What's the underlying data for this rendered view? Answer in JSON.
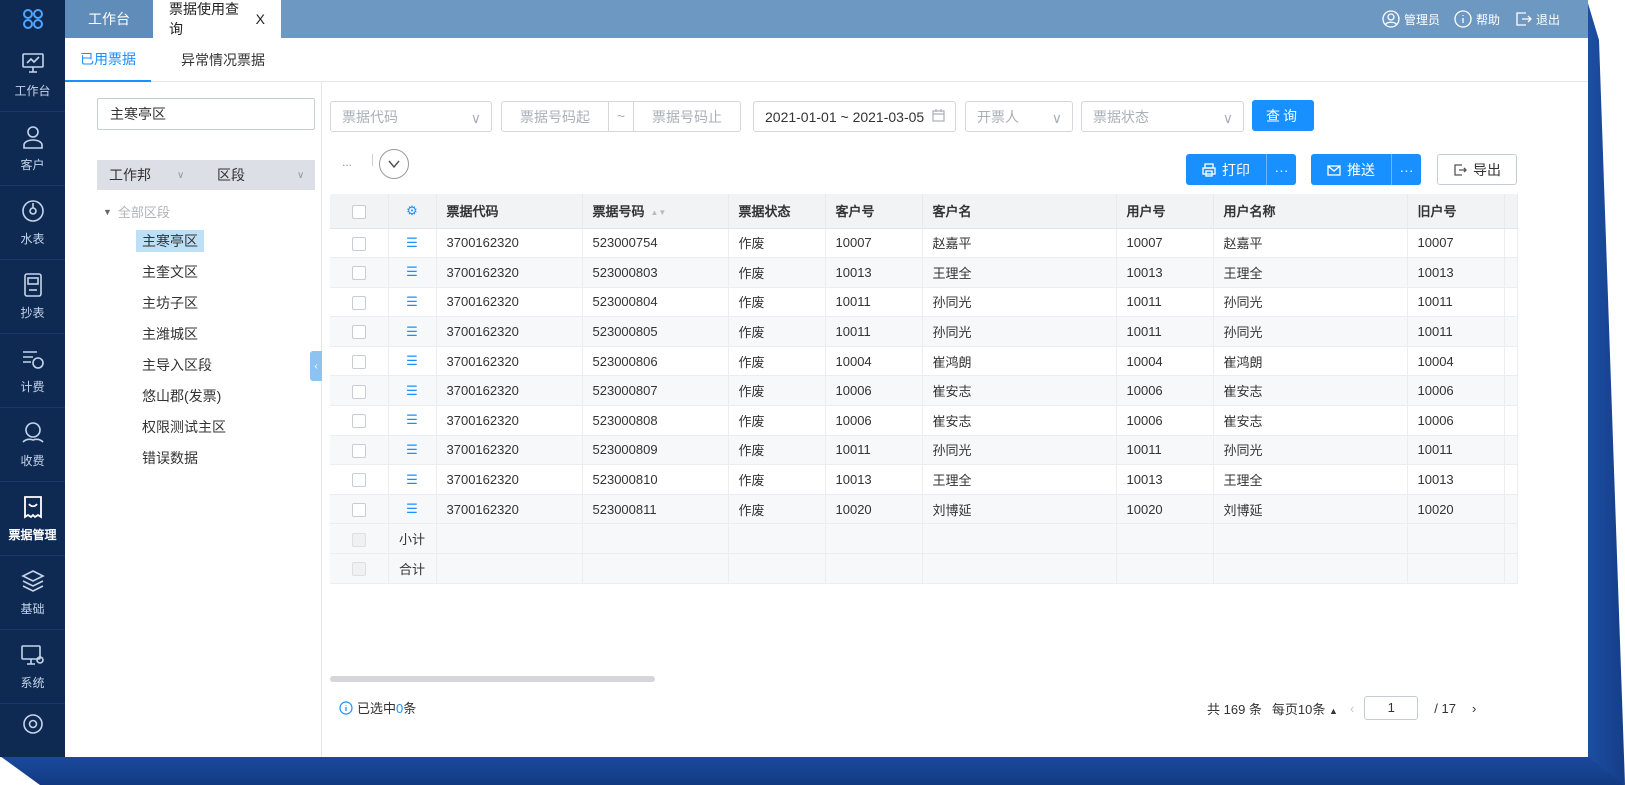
{
  "topbar": {
    "tabs": [
      {
        "label": "工作台"
      },
      {
        "label": "票据使用查询"
      }
    ],
    "close_glyph": "X",
    "user": "管理员",
    "help": "帮助",
    "logout": "退出"
  },
  "sidebar": {
    "items": [
      {
        "label": "工作台",
        "icon": "monitor-icon"
      },
      {
        "label": "客户",
        "icon": "person-icon"
      },
      {
        "label": "水表",
        "icon": "gauge-icon"
      },
      {
        "label": "抄表",
        "icon": "meter-device-icon"
      },
      {
        "label": "计费",
        "icon": "billing-icon"
      },
      {
        "label": "收费",
        "icon": "payment-icon"
      },
      {
        "label": "票据管理",
        "icon": "ticket-icon"
      },
      {
        "label": "基础",
        "icon": "layers-icon"
      },
      {
        "label": "系统",
        "icon": "system-settings-icon"
      }
    ]
  },
  "subtabs": [
    {
      "label": "已用票据"
    },
    {
      "label": "异常情况票据"
    }
  ],
  "left_panel": {
    "area_value": "主寒亭区",
    "head_cols": [
      "工作邦",
      "区段"
    ],
    "root": "全部区段",
    "nodes": [
      "主寒亭区",
      "主奎文区",
      "主坊子区",
      "主潍城区",
      "主导入区段",
      "悠山郡(发票)",
      "权限测试主区",
      "错误数据"
    ]
  },
  "filters": {
    "code_placeholder": "票据代码",
    "num_start_placeholder": "票据号码起",
    "tilde": "~",
    "num_end_placeholder": "票据号码止",
    "date_range": "2021-01-01 ~ 2021-03-05",
    "issuer_placeholder": "开票人",
    "status_placeholder": "票据状态",
    "query_label": "查询"
  },
  "toolbar": {
    "ellipsis": "...",
    "print_label": "打印",
    "push_label": "推送",
    "more": "···",
    "export_label": "导出"
  },
  "table": {
    "headers": [
      "票据代码",
      "票据号码",
      "票据状态",
      "客户号",
      "客户名",
      "用户号",
      "用户名称",
      "旧户号"
    ],
    "rows": [
      [
        "3700162320",
        "523000754",
        "作废",
        "10007",
        "赵嘉平",
        "10007",
        "赵嘉平",
        "10007"
      ],
      [
        "3700162320",
        "523000803",
        "作废",
        "10013",
        "王理全",
        "10013",
        "王理全",
        "10013"
      ],
      [
        "3700162320",
        "523000804",
        "作废",
        "10011",
        "孙同光",
        "10011",
        "孙同光",
        "10011"
      ],
      [
        "3700162320",
        "523000805",
        "作废",
        "10011",
        "孙同光",
        "10011",
        "孙同光",
        "10011"
      ],
      [
        "3700162320",
        "523000806",
        "作废",
        "10004",
        "崔鸿朗",
        "10004",
        "崔鸿朗",
        "10004"
      ],
      [
        "3700162320",
        "523000807",
        "作废",
        "10006",
        "崔安志",
        "10006",
        "崔安志",
        "10006"
      ],
      [
        "3700162320",
        "523000808",
        "作废",
        "10006",
        "崔安志",
        "10006",
        "崔安志",
        "10006"
      ],
      [
        "3700162320",
        "523000809",
        "作废",
        "10011",
        "孙同光",
        "10011",
        "孙同光",
        "10011"
      ],
      [
        "3700162320",
        "523000810",
        "作废",
        "10013",
        "王理全",
        "10013",
        "王理全",
        "10013"
      ],
      [
        "3700162320",
        "523000811",
        "作废",
        "10020",
        "刘博延",
        "10020",
        "刘博延",
        "10020"
      ]
    ],
    "subtotal_label": "小计",
    "total_label": "合计"
  },
  "footer": {
    "selected_prefix": "已选中",
    "selected_count": "0",
    "selected_suffix": "条",
    "total_text": "共 169 条",
    "page_size": "每页10条",
    "current_page": "1",
    "page_total": "/  17"
  },
  "colors": {
    "sidebar": "#0f2a52",
    "topbar": "#6d98c2",
    "accent": "#1890ff"
  }
}
